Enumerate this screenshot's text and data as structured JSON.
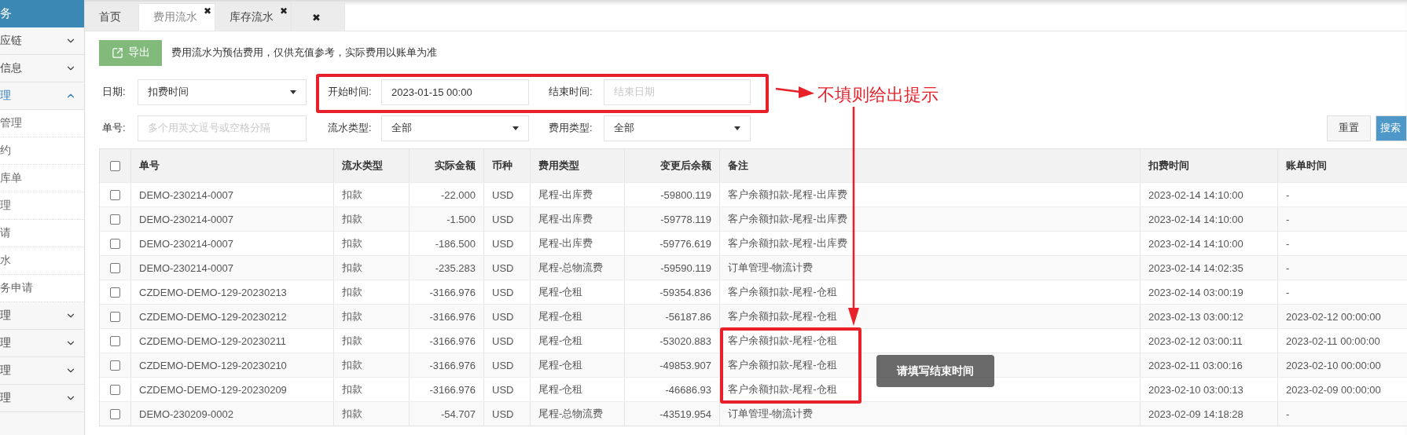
{
  "sidebar": {
    "header": "务",
    "items": [
      {
        "label": "应链",
        "expanded": false
      },
      {
        "label": "信息",
        "expanded": false
      },
      {
        "label": "理",
        "expanded": true,
        "children": [
          {
            "label": "管理"
          },
          {
            "label": "约"
          },
          {
            "label": "库单"
          },
          {
            "label": "理"
          },
          {
            "label": "请"
          },
          {
            "label": "水"
          },
          {
            "label": "务申请"
          }
        ]
      },
      {
        "label": "理",
        "expanded": false
      },
      {
        "label": "理",
        "expanded": false
      },
      {
        "label": "理",
        "expanded": false
      },
      {
        "label": "理",
        "expanded": false
      }
    ]
  },
  "tabs": [
    {
      "label": "首页",
      "selected": false
    },
    {
      "label": "费用流水",
      "close": "✖",
      "selected": true
    },
    {
      "label": "库存流水",
      "close": "✖",
      "selected": false
    },
    {
      "close": "✖",
      "selected": false
    }
  ],
  "toolbar": {
    "export_button": "导出",
    "notice": "费用流水为预估费用，仅供充值参考，实际费用以账单为准"
  },
  "filters": {
    "date_label": "日期:",
    "date_type": "扣费时间",
    "start_label": "开始时间:",
    "start_value": "2023-01-15 00:00",
    "end_label": "结束时间:",
    "end_placeholder": "结束日期",
    "number_label": "单号:",
    "number_placeholder": "多个用英文逗号或空格分隔",
    "flow_type_label": "流水类型:",
    "flow_type": "全部",
    "fee_type_label": "费用类型:",
    "fee_type": "全部",
    "reset_button": "重置",
    "search_button": "搜索"
  },
  "table": {
    "header_checked": false,
    "columns": [
      "单号",
      "流水类型",
      "实际金额",
      "币种",
      "费用类型",
      "变更后余额",
      "备注",
      "扣费时间",
      "账单时间"
    ],
    "rows": [
      {
        "checked": false,
        "cells": [
          "DEMO-230214-0007",
          "扣款",
          "-22.000",
          "USD",
          "尾程-出库费",
          "-59800.119",
          "客户余额扣款-尾程-出库费",
          "2023-02-14 14:10:00",
          "-"
        ]
      },
      {
        "checked": false,
        "cells": [
          "DEMO-230214-0007",
          "扣款",
          "-1.500",
          "USD",
          "尾程-出库费",
          "-59778.119",
          "客户余额扣款-尾程-出库费",
          "2023-02-14 14:10:00",
          "-"
        ]
      },
      {
        "checked": false,
        "cells": [
          "DEMO-230214-0007",
          "扣款",
          "-186.500",
          "USD",
          "尾程-出库费",
          "-59776.619",
          "客户余额扣款-尾程-出库费",
          "2023-02-14 14:10:00",
          "-"
        ]
      },
      {
        "checked": false,
        "cells": [
          "DEMO-230214-0007",
          "扣款",
          "-235.283",
          "USD",
          "尾程-总物流费",
          "-59590.119",
          "订单管理-物流计费",
          "2023-02-14 14:02:35",
          "-"
        ]
      },
      {
        "checked": false,
        "cells": [
          "CZDEMO-DEMO-129-20230213",
          "扣款",
          "-3166.976",
          "USD",
          "尾程-仓租",
          "-59354.836",
          "客户余额扣款-尾程-仓租",
          "2023-02-14 03:00:19",
          "-"
        ]
      },
      {
        "checked": false,
        "cells": [
          "CZDEMO-DEMO-129-20230212",
          "扣款",
          "-3166.976",
          "USD",
          "尾程-仓租",
          "-56187.86",
          "客户余额扣款-尾程-仓租",
          "2023-02-13 03:00:12",
          "2023-02-12 00:00:00"
        ]
      },
      {
        "checked": false,
        "cells": [
          "CZDEMO-DEMO-129-20230211",
          "扣款",
          "-3166.976",
          "USD",
          "尾程-仓租",
          "-53020.883",
          "客户余额扣款-尾程-仓租",
          "2023-02-12 03:00:11",
          "2023-02-11 00:00:00"
        ]
      },
      {
        "checked": false,
        "cells": [
          "CZDEMO-DEMO-129-20230210",
          "扣款",
          "-3166.976",
          "USD",
          "尾程-仓租",
          "-49853.907",
          "客户余额扣款-尾程-仓租",
          "2023-02-11 03:00:16",
          "2023-02-10 00:00:00"
        ]
      },
      {
        "checked": false,
        "cells": [
          "CZDEMO-DEMO-129-20230209",
          "扣款",
          "-3166.976",
          "USD",
          "尾程-仓租",
          "-46686.93",
          "客户余额扣款-尾程-仓租",
          "2023-02-10 03:00:13",
          "2023-02-09 00:00:00"
        ]
      },
      {
        "checked": false,
        "cells": [
          "DEMO-230209-0002",
          "扣款",
          "-54.707",
          "USD",
          "尾程-总物流费",
          "-43519.954",
          "订单管理-物流计费",
          "2023-02-09 14:18:28",
          "-"
        ]
      }
    ]
  },
  "annotation": {
    "note": "不填则给出提示"
  },
  "toast": {
    "message": "请填写结束时间"
  }
}
